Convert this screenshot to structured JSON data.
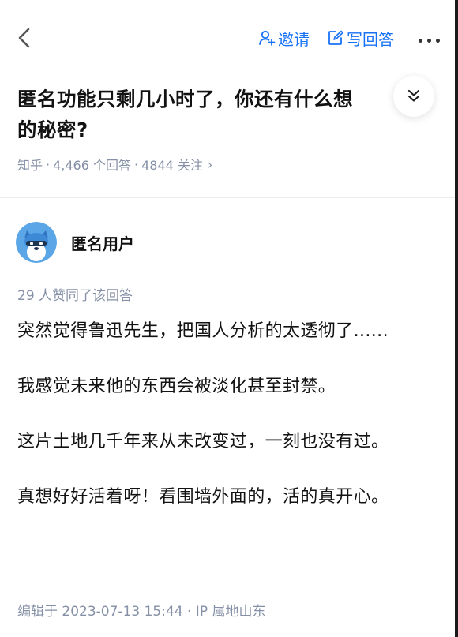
{
  "topbar": {
    "invite_label": "邀请",
    "write_answer_label": "写回答"
  },
  "question": {
    "title": "匿名功能只剩几小时了，你还有什么想",
    "title_line2": "的秘密?",
    "source": "知乎",
    "answers_count": "4,466 个回答",
    "followers_count": "4844 关注",
    "meta_chevron": "›"
  },
  "answer": {
    "author_name": "匿名用户",
    "votes_text": "29 人赞同了该回答",
    "paragraphs": [
      "突然觉得鲁迅先生，把国人分析的太透彻了......",
      "我感觉未来他的东西会被淡化甚至封禁。",
      "这片土地几千年来从未改变过，一刻也没有过。",
      "真想好好活着呀！看围墙外面的，活的真开心。"
    ],
    "edit_info": "编辑于 2023-07-13 15:44 · IP 属地山东"
  },
  "colors": {
    "accent": "#1772f6",
    "meta_gray": "#8590a6",
    "text": "#121212",
    "avatar_bg": "#5aa6e6"
  },
  "icons": {
    "back": "chevron-left-icon",
    "invite": "add-user-icon",
    "write": "edit-icon",
    "more": "more-dots-icon",
    "expand": "double-chevron-down-icon"
  }
}
